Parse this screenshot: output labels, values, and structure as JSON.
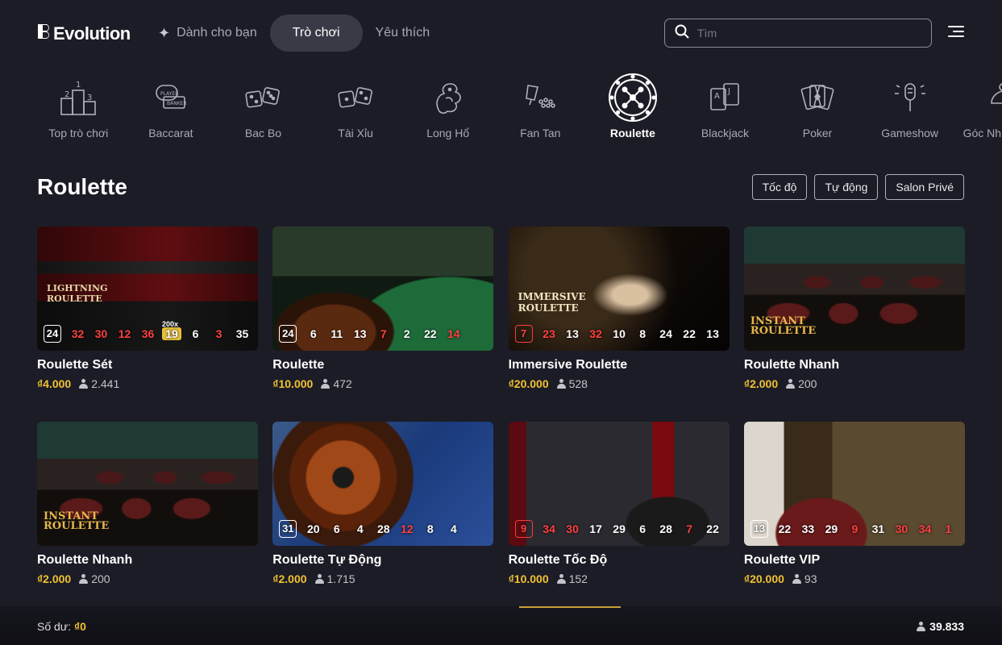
{
  "header": {
    "logo_text": "Evolution",
    "nav": [
      {
        "label": "Dành cho bạn",
        "icon": "sparkle-icon"
      },
      {
        "label": "Trò chơi",
        "active": true
      },
      {
        "label": "Yêu thích"
      }
    ],
    "search_placeholder": "Tìm"
  },
  "categories": [
    {
      "label": "Top trò chơi",
      "icon": "podium-icon"
    },
    {
      "label": "Baccarat",
      "icon": "baccarat-icon"
    },
    {
      "label": "Bac Bo",
      "icon": "dice-icon"
    },
    {
      "label": "Tài Xỉu",
      "icon": "dice-icon"
    },
    {
      "label": "Long Hổ",
      "icon": "dragon-icon"
    },
    {
      "label": "Fan Tan",
      "icon": "fan-tan-icon"
    },
    {
      "label": "Roulette",
      "icon": "roulette-icon",
      "active": true
    },
    {
      "label": "Blackjack",
      "icon": "blackjack-cards-icon"
    },
    {
      "label": "Poker",
      "icon": "poker-cards-icon"
    },
    {
      "label": "Gameshow",
      "icon": "microphone-icon"
    },
    {
      "label": "Góc Nh… Nh…",
      "icon": "corner-icon"
    }
  ],
  "section": {
    "title": "Roulette",
    "filters": [
      "Tốc độ",
      "Tự động",
      "Salon Privé"
    ]
  },
  "games": [
    {
      "name": "Roulette Sét",
      "price": "₫4.000",
      "players": "2.441",
      "results": [
        {
          "v": "24",
          "c": "w"
        },
        {
          "v": "32",
          "c": "r"
        },
        {
          "v": "30",
          "c": "r"
        },
        {
          "v": "12",
          "c": "r"
        },
        {
          "v": "36",
          "c": "r"
        },
        {
          "v": "19",
          "c": "m"
        },
        {
          "v": "6",
          "c": "w"
        },
        {
          "v": "3",
          "c": "r"
        },
        {
          "v": "35",
          "c": "w"
        }
      ],
      "logo": "LIGHTNING ROULETTE",
      "multiplier_label": "200x",
      "scene": "lightning"
    },
    {
      "name": "Roulette",
      "price": "₫10.000",
      "players": "472",
      "results": [
        {
          "v": "24",
          "c": "w"
        },
        {
          "v": "6",
          "c": "w"
        },
        {
          "v": "11",
          "c": "w"
        },
        {
          "v": "13",
          "c": "w"
        },
        {
          "v": "7",
          "c": "r"
        },
        {
          "v": "2",
          "c": "w"
        },
        {
          "v": "22",
          "c": "w"
        },
        {
          "v": "14",
          "c": "r"
        }
      ],
      "scene": "classic"
    },
    {
      "name": "Immersive Roulette",
      "price": "₫20.000",
      "players": "528",
      "results": [
        {
          "v": "7",
          "c": "r"
        },
        {
          "v": "23",
          "c": "r"
        },
        {
          "v": "13",
          "c": "w"
        },
        {
          "v": "32",
          "c": "r"
        },
        {
          "v": "10",
          "c": "w"
        },
        {
          "v": "8",
          "c": "w"
        },
        {
          "v": "24",
          "c": "w"
        },
        {
          "v": "22",
          "c": "w"
        },
        {
          "v": "13",
          "c": "w"
        }
      ],
      "logo": "IMMERSIVE ROULETTE",
      "scene": "immersive"
    },
    {
      "name": "Roulette Nhanh",
      "price": "₫2.000",
      "players": "200",
      "results": [],
      "logo": "INSTANT ROULETTE",
      "scene": "instant"
    },
    {
      "name": "Roulette Nhanh",
      "price": "₫2.000",
      "players": "200",
      "results": [],
      "logo": "INSTANT ROULETTE",
      "scene": "instant"
    },
    {
      "name": "Roulette Tự Động",
      "price": "₫2.000",
      "players": "1.715",
      "results": [
        {
          "v": "31",
          "c": "w"
        },
        {
          "v": "20",
          "c": "w"
        },
        {
          "v": "6",
          "c": "w"
        },
        {
          "v": "4",
          "c": "w"
        },
        {
          "v": "28",
          "c": "w"
        },
        {
          "v": "12",
          "c": "r"
        },
        {
          "v": "8",
          "c": "w"
        },
        {
          "v": "4",
          "c": "w"
        }
      ],
      "scene": "auto"
    },
    {
      "name": "Roulette Tốc Độ",
      "price": "₫10.000",
      "players": "152",
      "results": [
        {
          "v": "9",
          "c": "r"
        },
        {
          "v": "34",
          "c": "r"
        },
        {
          "v": "30",
          "c": "r"
        },
        {
          "v": "17",
          "c": "w"
        },
        {
          "v": "29",
          "c": "w"
        },
        {
          "v": "6",
          "c": "w"
        },
        {
          "v": "28",
          "c": "w"
        },
        {
          "v": "7",
          "c": "r"
        },
        {
          "v": "22",
          "c": "w"
        }
      ],
      "scene": "speed"
    },
    {
      "name": "Roulette VIP",
      "price": "₫20.000",
      "players": "93",
      "results": [
        {
          "v": "13",
          "c": "w"
        },
        {
          "v": "22",
          "c": "w"
        },
        {
          "v": "33",
          "c": "w"
        },
        {
          "v": "29",
          "c": "w"
        },
        {
          "v": "9",
          "c": "r"
        },
        {
          "v": "31",
          "c": "w"
        },
        {
          "v": "30",
          "c": "r"
        },
        {
          "v": "34",
          "c": "r"
        },
        {
          "v": "1",
          "c": "r"
        }
      ],
      "scene": "vip"
    }
  ],
  "footer": {
    "balance_label": "Số dư:",
    "balance_value": "₫0",
    "online_count": "39.833"
  },
  "colors": {
    "accent": "#f1c232",
    "red": "#ff4040",
    "background": "#1c1c26"
  }
}
